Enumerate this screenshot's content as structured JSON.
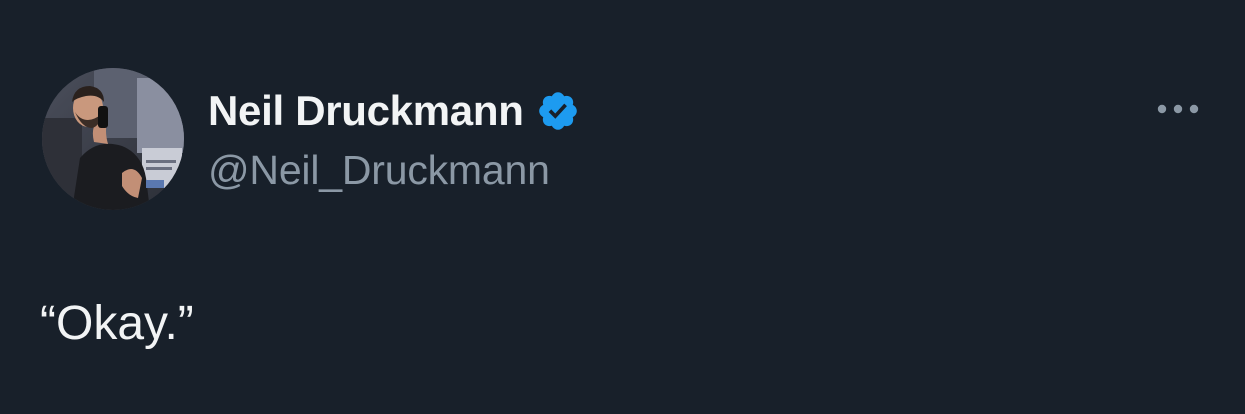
{
  "tweet": {
    "author": {
      "display_name": "Neil Druckmann",
      "handle": "@Neil_Druckmann",
      "verified": true,
      "avatar": "profile-photo"
    },
    "text": "“Okay.”",
    "more_icon": "more-horizontal-icon"
  },
  "colors": {
    "background": "#18202a",
    "name": "#f2f4f5",
    "handle": "#8b98a5",
    "verified_blue": "#1d9bf0",
    "icon_gray": "#8b98a5"
  }
}
